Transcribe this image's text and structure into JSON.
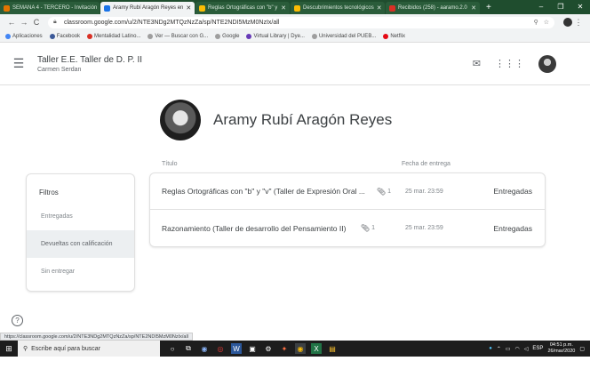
{
  "browser": {
    "tabs": [
      {
        "label": "SEMANA 4 - TERCERO - Invitación",
        "color": "#e37400",
        "active": false
      },
      {
        "label": "Aramy Rubí Aragón Reyes en",
        "color": "#1a73e8",
        "active": true
      },
      {
        "label": "Reglas Ortográficas con \"b\" y",
        "color": "#fbbc04",
        "active": false
      },
      {
        "label": "Descubrimientos tecnológicos",
        "color": "#fbbc04",
        "active": false
      },
      {
        "label": "Recibidos (258) - aaramo.2.0",
        "color": "#d93025",
        "active": false
      }
    ],
    "new_tab": "+",
    "window_controls": [
      "–",
      "❐",
      "✕"
    ],
    "url": "classroom.google.com/u/2/NTE3NDg2MTQzNzZa/sp/NTE2NDI5MzM0NzIx/all",
    "back": "←",
    "forward": "→",
    "reload": "C",
    "bookmarks": [
      {
        "label": "Aplicaciones",
        "color": "#4285f4"
      },
      {
        "label": "Facebook",
        "color": "#3b5998"
      },
      {
        "label": "Mentalidad Latino...",
        "color": "#d93025"
      },
      {
        "label": "Ver — Buscar con G...",
        "color": "#9e9e9e"
      },
      {
        "label": "Google",
        "color": "#9e9e9e"
      },
      {
        "label": "Virtual Library | Dye...",
        "color": "#673ab7"
      },
      {
        "label": "Universidad del PUEB...",
        "color": "#9e9e9e"
      },
      {
        "label": "Netflix",
        "color": "#e50914"
      }
    ]
  },
  "classroom": {
    "course_title": "Taller E.E. Taller de D. P. II",
    "course_teacher": "Carmen Serdan",
    "student_name": "Aramy Rubí Aragón Reyes",
    "filters_title": "Filtros",
    "filters": [
      {
        "label": "Entregadas",
        "selected": false
      },
      {
        "label": "Devueltas con calificación",
        "selected": true
      },
      {
        "label": "Sin entregar",
        "selected": false
      }
    ],
    "col_titulo": "Título",
    "col_fecha": "Fecha de entrega",
    "work": [
      {
        "title": "Reglas Ortográficas con \"b\" y \"v\" (Taller de Expresión Oral ...",
        "attachments": "1",
        "date": "25 mar. 23:59",
        "status": "Entregadas"
      },
      {
        "title": "Razonamiento (Taller de desarrollo del Pensamiento II)",
        "attachments": "1",
        "date": "25 mar. 23:59",
        "status": "Entregadas"
      }
    ],
    "help": "?"
  },
  "status_bar_url": "https://classroom.google.com/u/2/NTE3NDg2MTQzNzZa/sp/NTE2NDI5MzM0NzIx/all",
  "taskbar": {
    "search_placeholder": "Escribe aquí para buscar",
    "time": "04:51 p.m.",
    "date": "26/mar/2020",
    "lang": "ESP"
  }
}
